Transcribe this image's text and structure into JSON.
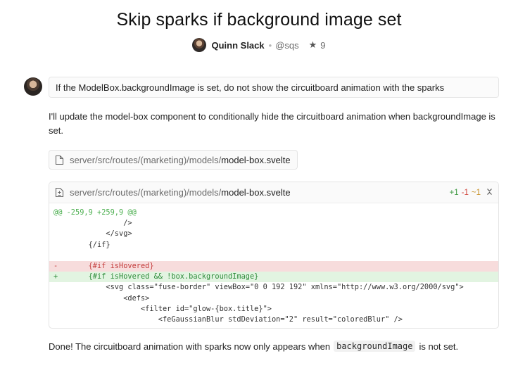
{
  "thread": {
    "title": "Skip sparks if background image set",
    "author": "Quinn Slack",
    "separator": "•",
    "handle": "@sqs",
    "stars": "9"
  },
  "user_message": "If the ModelBox.backgroundImage is set, do not show the circuitboard animation with the sparks",
  "assistant": {
    "reply": "I'll update the model-box component to conditionally hide the circuitboard animation when backgroundImage is set.",
    "file_chip": {
      "dir": "server/src/routes/(marketing)/models/",
      "file": "model-box.svelte"
    },
    "diff": {
      "dir": "server/src/routes/(marketing)/models/",
      "file": "model-box.svelte",
      "added": "+1",
      "removed": "-1",
      "modified": "~1",
      "lines": [
        {
          "kind": "hunk",
          "text": "@@ -259,9 +259,9 @@"
        },
        {
          "kind": "ctx",
          "text": "                />"
        },
        {
          "kind": "ctx",
          "text": "            </svg>"
        },
        {
          "kind": "ctx",
          "text": "        {/if}"
        },
        {
          "kind": "ctx",
          "text": ""
        },
        {
          "kind": "del",
          "text": "-       {#if isHovered}"
        },
        {
          "kind": "add",
          "text": "+       {#if isHovered && !box.backgroundImage}"
        },
        {
          "kind": "ctx",
          "text": "            <svg class=\"fuse-border\" viewBox=\"0 0 192 192\" xmlns=\"http://www.w3.org/2000/svg\">"
        },
        {
          "kind": "ctx",
          "text": "                <defs>"
        },
        {
          "kind": "ctx",
          "text": "                    <filter id=\"glow-{box.title}\">"
        },
        {
          "kind": "ctx",
          "text": "                        <feGaussianBlur stdDeviation=\"2\" result=\"coloredBlur\" />"
        }
      ]
    },
    "done_before": "Done! The circuitboard animation with sparks now only appears when",
    "done_code": "backgroundImage",
    "done_after": "is not set."
  },
  "icons": {
    "star": "star-icon",
    "file": "file-icon",
    "diff_file": "diff-file-icon",
    "collapse": "collapse-icon"
  }
}
